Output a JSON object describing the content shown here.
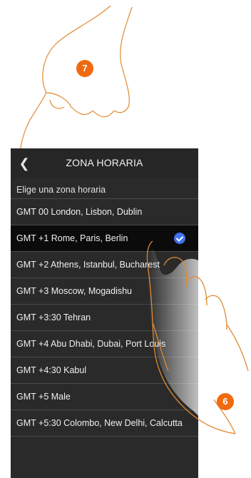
{
  "header": {
    "title": "ZONA HORARIA",
    "back_icon": "chevron-left-icon"
  },
  "subtitle": "Elige una zona horaria",
  "timezones": [
    {
      "label": "GMT 00 London, Lisbon, Dublin",
      "selected": false
    },
    {
      "label": "GMT +1 Rome, Paris, Berlin",
      "selected": true
    },
    {
      "label": "GMT +2 Athens, Istanbul, Bucharest",
      "selected": false
    },
    {
      "label": "GMT +3 Moscow, Mogadishu",
      "selected": false
    },
    {
      "label": "GMT +3:30 Tehran",
      "selected": false
    },
    {
      "label": "GMT +4 Abu Dhabi, Dubai, Port Louis",
      "selected": false
    },
    {
      "label": "GMT +4:30 Kabul",
      "selected": false
    },
    {
      "label": "GMT +5 Male",
      "selected": false
    },
    {
      "label": "GMT +5:30 Colombo, New Delhi, Calcutta",
      "selected": false
    }
  ],
  "badges": {
    "step_top": "7",
    "step_bottom": "6"
  },
  "colors": {
    "accent_check": "#3f73f1",
    "badge": "#f06a10",
    "hand_outline": "#e08a32"
  }
}
